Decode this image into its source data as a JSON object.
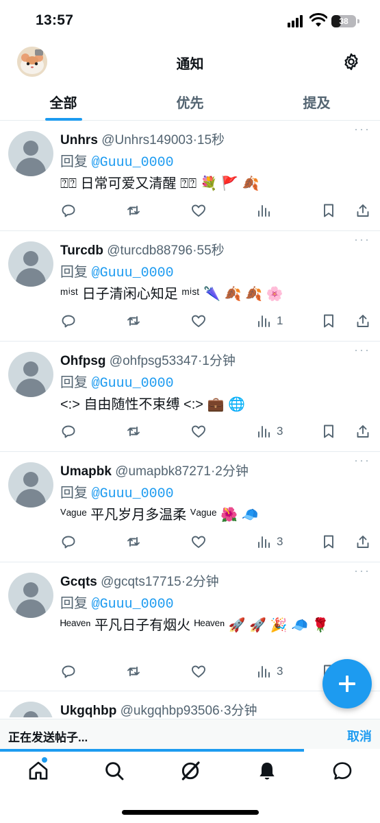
{
  "status_bar": {
    "time": "13:57",
    "battery": "38",
    "battery_level": 0.38
  },
  "header": {
    "title": "通知",
    "avatar": "profile-avatar",
    "settings_icon": "gear-icon"
  },
  "tabs": [
    {
      "label": "全部",
      "active": true
    },
    {
      "label": "优先",
      "active": false
    },
    {
      "label": "提及",
      "active": false
    }
  ],
  "reply_prefix": "回复",
  "posts": [
    {
      "name": "Unhrs",
      "handle": "@Unhrs149003",
      "time": "15秒",
      "reply_to": "@Guuu_0000",
      "text": "⍰⍰ 日常可爱又清醒 ⍰⍰ 💐 🚩 🍂",
      "views": ""
    },
    {
      "name": "Turcdb",
      "handle": "@turcdb88796",
      "time": "55秒",
      "reply_to": "@Guuu_0000",
      "text": "ᵐⁱˢᵗ 日子清闲心知足 ᵐⁱˢᵗ 🌂 🍂 🍂 🌸",
      "views": "1"
    },
    {
      "name": "Ohfpsg",
      "handle": "@ohfpsg53347",
      "time": "1分钟",
      "reply_to": "@Guuu_0000",
      "text": "<:> 自由随性不束缚 <:> 💼 🌐",
      "views": "3"
    },
    {
      "name": "Umapbk",
      "handle": "@umapbk87271",
      "time": "2分钟",
      "reply_to": "@Guuu_0000",
      "text": "ⱽᵃᵍᵘᵉ 平凡岁月多温柔 ⱽᵃᵍᵘᵉ 🌺 🧢",
      "views": "3"
    },
    {
      "name": "Gcqts",
      "handle": "@gcqts17715",
      "time": "2分钟",
      "reply_to": "@Guuu_0000",
      "text": "ᴴᵉᵃᵛᵉⁿ 平凡日子有烟火 ᴴᵉᵃᵛᵉⁿ 🚀 🚀 🎉 🧢 🌹",
      "views": "3"
    },
    {
      "name": "Ukgqhbp",
      "handle": "@ukgqhbp93506",
      "time": "3分钟",
      "reply_to": "",
      "text": "",
      "views": ""
    }
  ],
  "sending_bar": {
    "text": "正在发送帖子...",
    "cancel": "取消",
    "progress": 0.8
  },
  "bottom_nav": [
    {
      "icon": "home-icon",
      "notification_dot": true
    },
    {
      "icon": "search-icon",
      "notification_dot": false
    },
    {
      "icon": "grok-icon",
      "notification_dot": false
    },
    {
      "icon": "bell-icon",
      "notification_dot": false
    },
    {
      "icon": "messages-icon",
      "notification_dot": false
    }
  ],
  "colors": {
    "accent": "#1d9bf0",
    "text": "#0f1419",
    "secondary": "#536471",
    "avatar_bg": "#cfd9de"
  }
}
